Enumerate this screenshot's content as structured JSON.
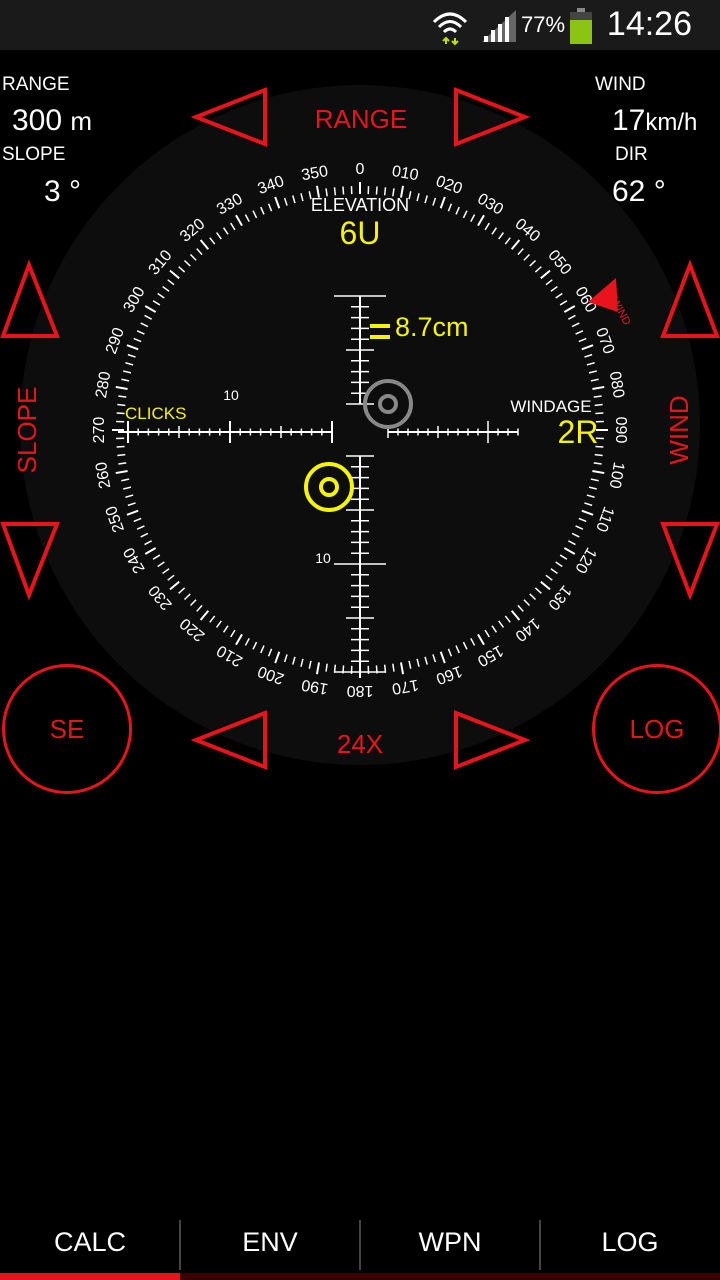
{
  "status": {
    "battery": "77%",
    "time": "14:26",
    "icons": [
      "wifi-icon",
      "signal-icon",
      "battery-icon"
    ]
  },
  "info": {
    "range_label": "RANGE",
    "range_value": "300",
    "range_unit": "m",
    "slope_label": "SLOPE",
    "slope_value": "3",
    "slope_unit": "°",
    "wind_label": "WIND",
    "wind_value": "17",
    "wind_unit": "km/h",
    "dir_label": "DIR",
    "dir_value": "62",
    "dir_unit": "°"
  },
  "controls": {
    "range_label": "RANGE",
    "zoom_label": "24X",
    "slope_label": "SLOPE",
    "wind_label": "WIND",
    "se_label": "SE",
    "log_label": "LOG"
  },
  "reticle": {
    "elevation_label": "ELEVATION",
    "elevation_value": "6U",
    "windage_label": "WINDAGE",
    "windage_value": "2R",
    "clicks_label": "CLICKS",
    "group_size": "8.7cm",
    "tick_10_h": "10",
    "tick_10_v": "10",
    "wind_marker_label": "WIND",
    "compass_labels": [
      "0",
      "010",
      "020",
      "030",
      "040",
      "050",
      "060",
      "070",
      "080",
      "090",
      "100",
      "110",
      "120",
      "130",
      "140",
      "150",
      "160",
      "170",
      "180",
      "190",
      "200",
      "210",
      "220",
      "230",
      "240",
      "250",
      "260",
      "270",
      "280",
      "290",
      "300",
      "310",
      "320",
      "330",
      "340",
      "350"
    ]
  },
  "colors": {
    "accent_red": "#e8141c",
    "highlight_yellow": "#f5f500",
    "status_bg": "#1a1a1a"
  },
  "tabs": [
    {
      "label": "CALC",
      "active": true
    },
    {
      "label": "ENV",
      "active": false
    },
    {
      "label": "WPN",
      "active": false
    },
    {
      "label": "LOG",
      "active": false
    }
  ]
}
